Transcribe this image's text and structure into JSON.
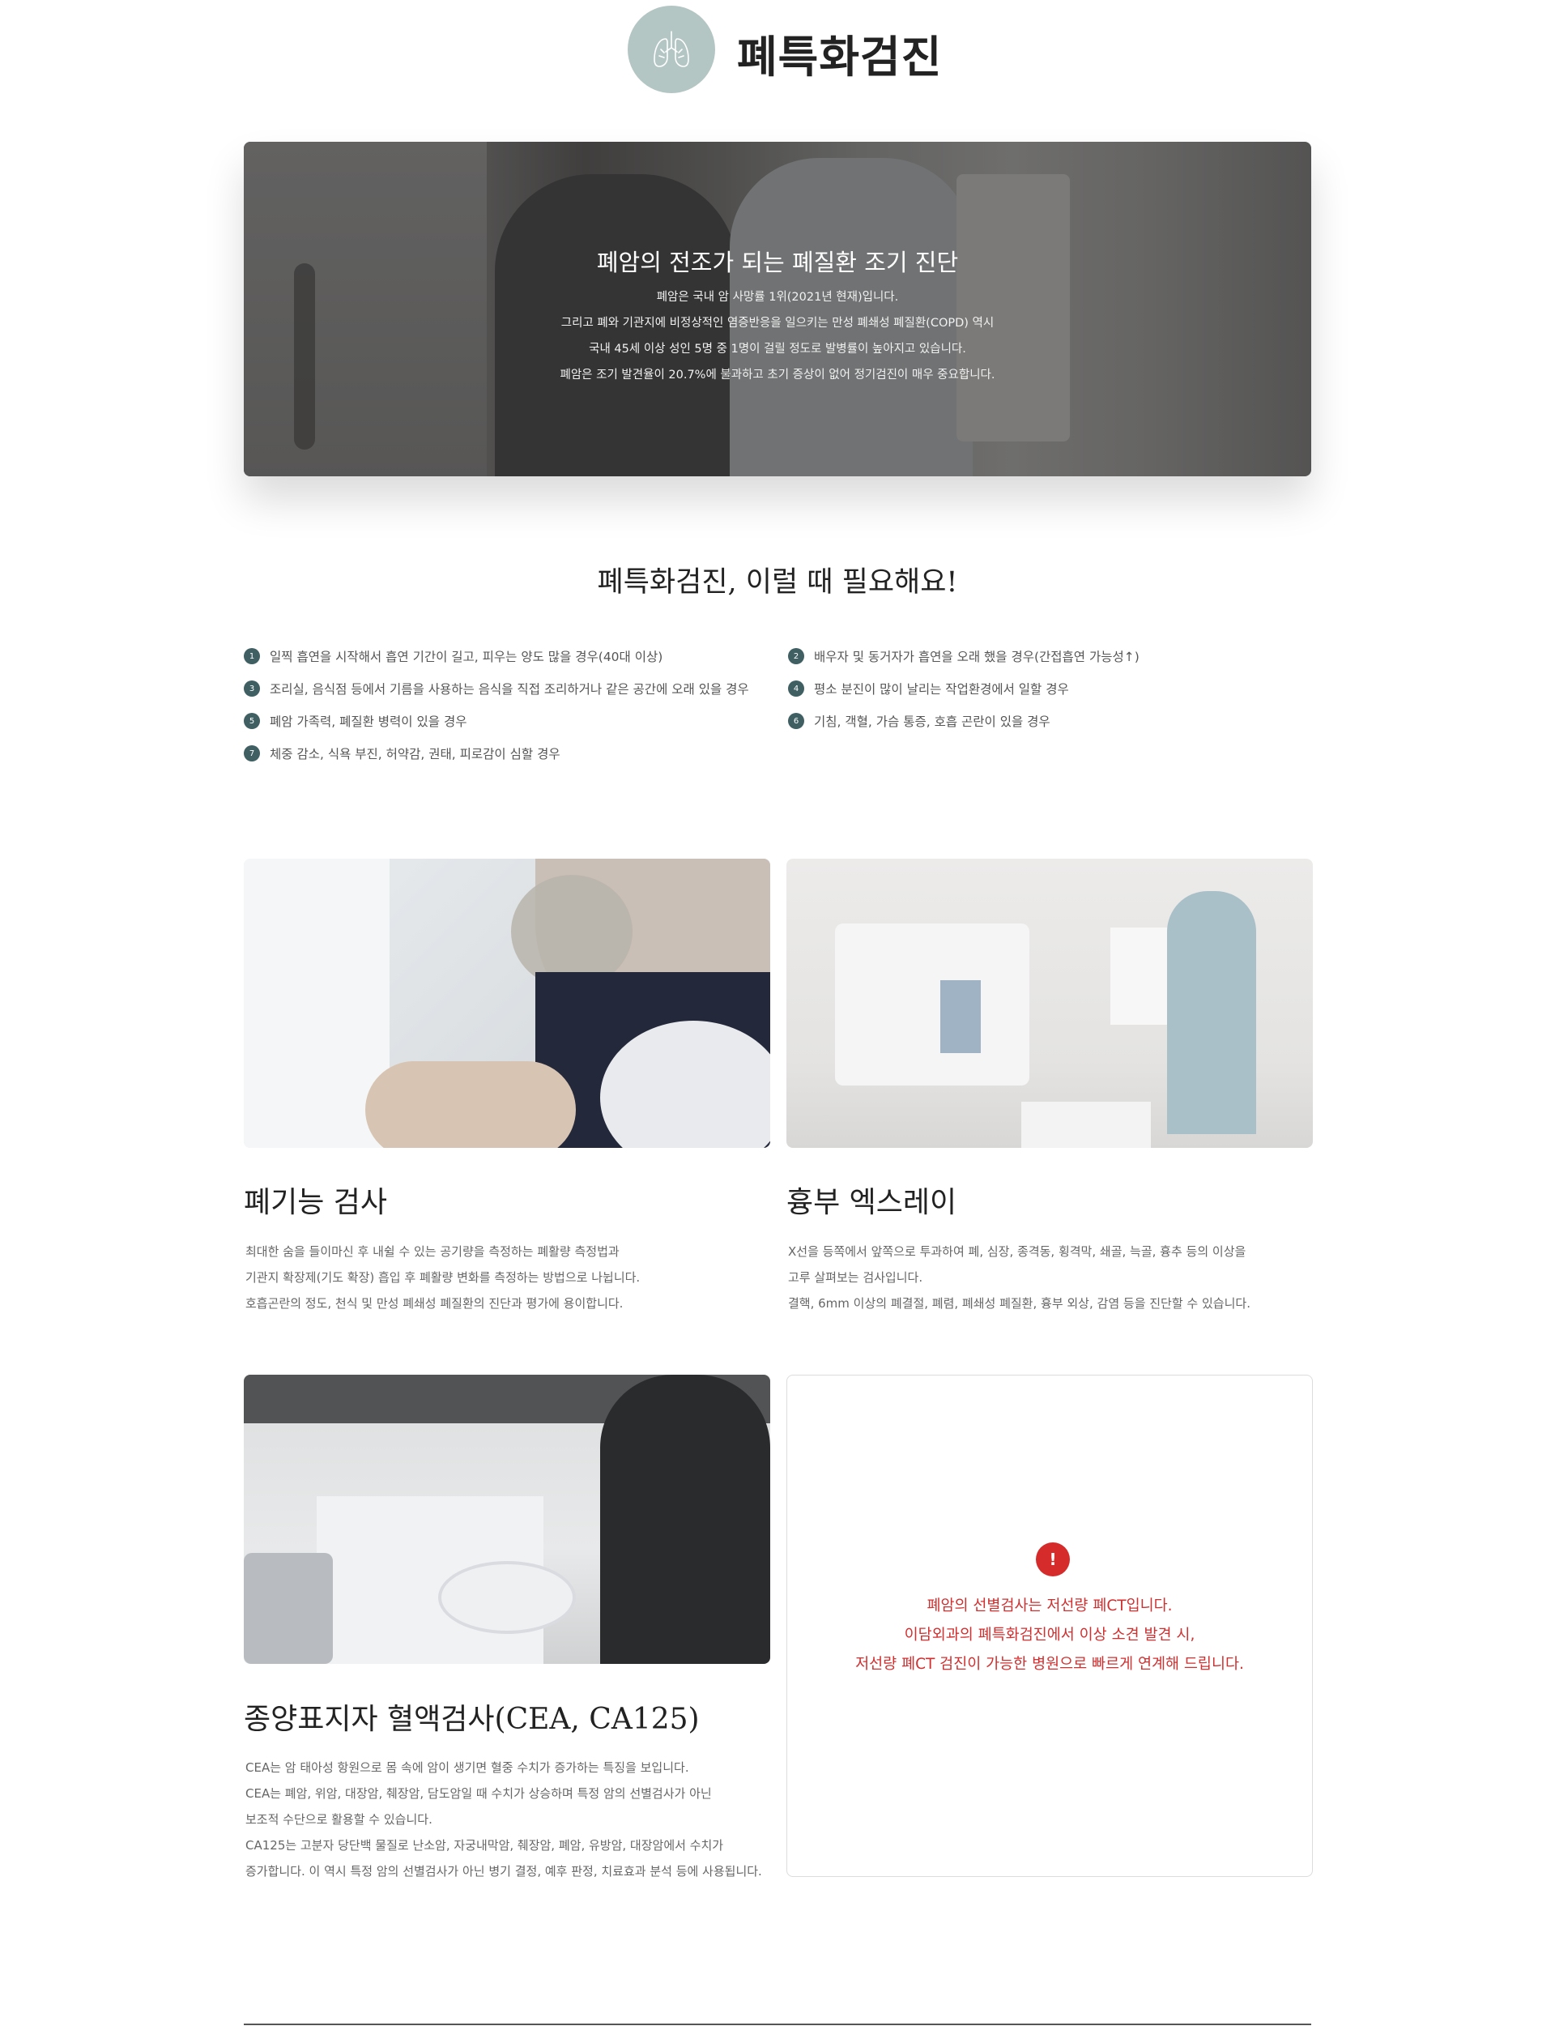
{
  "header": {
    "icon": "lungs-icon",
    "title": "폐특화검진",
    "colors": {
      "icon_bg": "#b3c6c4"
    }
  },
  "hero": {
    "title": "폐암의 전조가 되는 폐질환 조기 진단",
    "lines": [
      "폐암은 국내 암 사망률 1위(2021년 현재)입니다.",
      "그리고 폐와 기관지에 비정상적인 염증반응을 일으키는 만성 폐쇄성 폐질환(COPD) 역시",
      "국내 45세 이상 성인 5명 중 1명이 걸릴 정도로 발병률이 높아지고 있습니다.",
      "폐암은 조기 발견율이 20.7%에 불과하고 초기 증상이 없어 정기검진이 매우 중요합니다."
    ]
  },
  "needs": {
    "title": "폐특화검진, 이럴 때 필요해요!",
    "items": [
      {
        "num": "1",
        "text": "일찍 흡연을 시작해서 흡연 기간이 길고, 피우는 양도 많을 경우(40대 이상)"
      },
      {
        "num": "2",
        "text": "배우자 및 동거자가 흡연을 오래 했을 경우(간접흡연 가능성↑)"
      },
      {
        "num": "3",
        "text": "조리실, 음식점 등에서 기름을 사용하는 음식을 직접 조리하거나 같은 공간에 오래 있을 경우"
      },
      {
        "num": "4",
        "text": "평소 분진이 많이 날리는 작업환경에서 일할 경우"
      },
      {
        "num": "5",
        "text": "폐암 가족력, 폐질환 병력이 있을 경우"
      },
      {
        "num": "6",
        "text": "기침, 객혈, 가슴 통증, 호흡 곤란이 있을 경우"
      },
      {
        "num": "7",
        "text": "체중 감소, 식욕 부진, 허약감, 권태, 피로감이 심할 경우"
      }
    ],
    "colors": {
      "badge": "#3f5f63"
    }
  },
  "cards": [
    {
      "title": "폐기능 검사",
      "lines": [
        "최대한 숨을 들이마신 후 내쉴 수 있는 공기량을 측정하는 폐활량 측정법과",
        "기관지 확장제(기도 확장) 흡입 후 폐활량 변화를 측정하는 방법으로 나뉩니다.",
        "호흡곤란의 정도, 천식 및 만성 폐쇄성 폐질환의 진단과 평가에 용이합니다."
      ]
    },
    {
      "title": "흉부 엑스레이",
      "lines": [
        "X선을 등쪽에서 앞쪽으로 투과하여 폐, 심장, 종격동, 횡격막, 쇄골, 늑골, 흉추 등의 이상을",
        "고루 살펴보는 검사입니다.",
        "결핵, 6mm 이상의 폐결절, 폐렴, 폐쇄성 폐질환, 흉부 외상, 감염 등을 진단할 수 있습니다."
      ]
    },
    {
      "title": "종양표지자 혈액검사(CEA, CA125)",
      "lines": [
        "CEA는 암 태아성 항원으로 몸 속에 암이 생기면 혈중 수치가 증가하는 특징을 보입니다.",
        "CEA는 폐암, 위암, 대장암, 췌장암, 담도암일 때 수치가 상승하며 특정 암의 선별검사가 아닌",
        "보조적 수단으로 활용할 수 있습니다.",
        "CA125는 고분자 당단백 물질로 난소암, 자궁내막암, 췌장암, 폐암, 유방암, 대장암에서 수치가",
        "증가합니다. 이 역시 특정 암의 선별검사가 아닌 병기 결정, 예후 판정, 치료효과 분석 등에 사용됩니다."
      ]
    }
  ],
  "notice": {
    "icon": "exclamation-icon",
    "icon_glyph": "!",
    "lines": [
      "폐암의 선별검사는 저선량 폐CT입니다.",
      "이담외과의 폐특화검진에서 이상 소견 발견 시,",
      "저선량 폐CT 검진이 가능한 병원으로 빠르게 연계해 드립니다."
    ],
    "colors": {
      "accent": "#d52b2b"
    }
  }
}
